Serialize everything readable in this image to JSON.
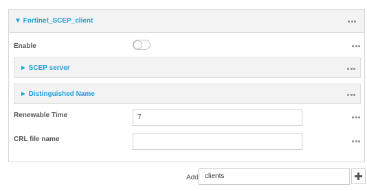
{
  "section": {
    "title": "▼ Fortinet_SCEP_client",
    "menu_icon": "more-horizontal-icon"
  },
  "fields": {
    "enable": {
      "label": "Enable",
      "value": false
    },
    "scep_server": {
      "label": "► SCEP server",
      "expanded": false
    },
    "distinguished_name": {
      "label": "► Distinguished Name",
      "expanded": false
    },
    "renewable_time": {
      "label": "Renewable Time",
      "value": "7"
    },
    "crl_file_name": {
      "label": "CRL file name",
      "value": ""
    }
  },
  "add": {
    "label": "Add",
    "value": "clients",
    "button_icon": "plus-icon"
  },
  "colors": {
    "accent": "#1ea0dc",
    "header_bg": "#f3f3f3",
    "border": "#d6d6d6"
  }
}
